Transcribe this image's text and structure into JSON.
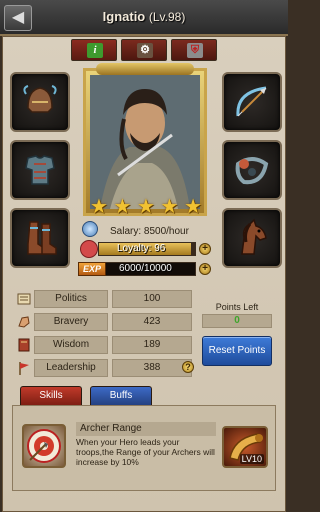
{
  "header": {
    "back_icon": "chevron-left-icon",
    "hero_name": "Ignatio",
    "hero_level": "(Lv.98)"
  },
  "top_tabs": [
    {
      "name": "info",
      "icon": "info-icon",
      "label": "i"
    },
    {
      "name": "gear",
      "icon": "gear-icon",
      "label": "⚙"
    },
    {
      "name": "army",
      "icon": "helmet-icon",
      "label": "⛨"
    }
  ],
  "equipment": {
    "helmet": "helmet-icon",
    "armor": "armor-icon",
    "boots": "boots-icon",
    "bow": "bow-icon",
    "horn": "horn-icon",
    "horse": "horse-icon"
  },
  "hero": {
    "stars": [
      "★",
      "★",
      "★",
      "★",
      "★"
    ],
    "salary": "Salary: 8500/hour",
    "loyalty": "Loyalty: 96",
    "loyalty_fraction": 0.96,
    "exp_tag": "EXP",
    "exp": "6000/10000",
    "exp_fraction": 0.6
  },
  "stats": [
    {
      "label": "Politics",
      "value": "100",
      "icon": "scroll-icon"
    },
    {
      "label": "Bravery",
      "value": "423",
      "icon": "fist-icon"
    },
    {
      "label": "Wisdom",
      "value": "189",
      "icon": "book-icon"
    },
    {
      "label": "Leadership",
      "value": "388",
      "icon": "banner-icon"
    }
  ],
  "points": {
    "label": "Points Left",
    "value": "0",
    "reset_label": "Reset Points",
    "help": "?"
  },
  "bottom_tabs": {
    "skills": "Skills",
    "buffs": "Buffs"
  },
  "skill": {
    "icon": "archery-target-icon",
    "title": "Archer Range",
    "description": "When your Hero leads your troops,the Range of your Archers will increase by 10%",
    "level_icon": "war-horn-icon",
    "level": "LV10"
  },
  "colors": {
    "accent_gold": "#c9a44a",
    "reset_blue": "#2f63bd",
    "skills_red": "#a52c1e",
    "points_green": "#3fa52c"
  }
}
